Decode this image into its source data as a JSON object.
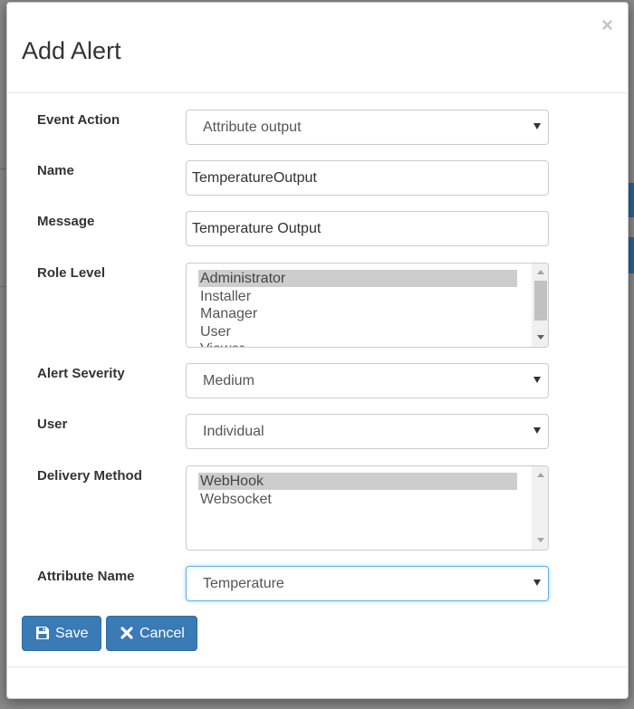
{
  "modal": {
    "title": "Add Alert",
    "close_glyph": "×"
  },
  "form": {
    "event_action": {
      "label": "Event Action",
      "value": "Attribute output"
    },
    "name": {
      "label": "Name",
      "value": "TemperatureOutput"
    },
    "message": {
      "label": "Message",
      "value": "Temperature Output"
    },
    "role_level": {
      "label": "Role Level",
      "options": [
        "Administrator",
        "Installer",
        "Manager",
        "User",
        "Viewer"
      ],
      "selected": "Administrator"
    },
    "alert_severity": {
      "label": "Alert Severity",
      "value": "Medium"
    },
    "user": {
      "label": "User",
      "value": "Individual"
    },
    "delivery_method": {
      "label": "Delivery Method",
      "options": [
        "WebHook",
        "Websocket"
      ],
      "selected": "WebHook"
    },
    "attribute_name": {
      "label": "Attribute Name",
      "value": "Temperature"
    }
  },
  "buttons": {
    "save_label": "Save",
    "cancel_label": "Cancel"
  },
  "icons": {
    "save": "floppy-disk-icon",
    "cancel": "x-icon",
    "close": "close-icon"
  },
  "colors": {
    "primary": "#3a7ab5",
    "selected_option": "#cdcdcd",
    "focus_border": "#66afe9"
  }
}
